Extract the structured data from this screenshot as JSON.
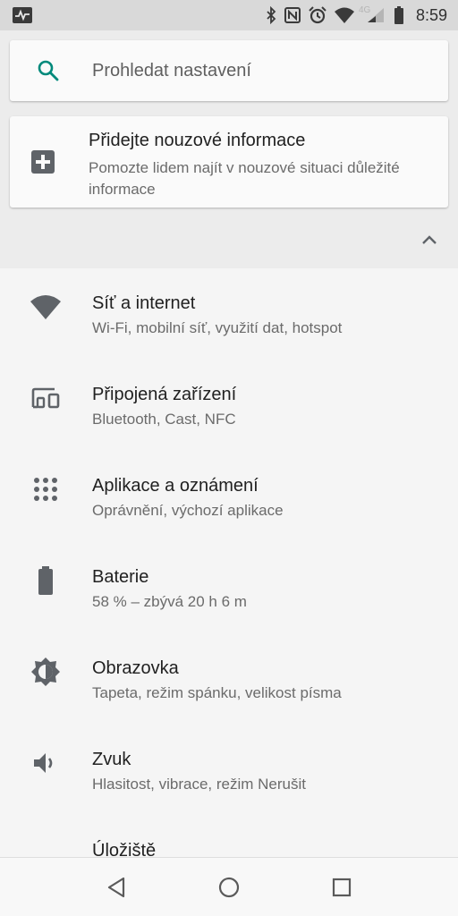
{
  "status_bar": {
    "time": "8:59",
    "network_label": "4G",
    "icons": [
      "activity-icon",
      "bluetooth-icon",
      "nfc-icon",
      "alarm-icon",
      "wifi-icon",
      "signal-icon",
      "battery-icon"
    ]
  },
  "search": {
    "placeholder": "Prohledat nastavení"
  },
  "suggestion": {
    "icon": "add-emergency-info-icon",
    "title": "Přidejte nouzové informace",
    "subtitle": "Pomozte lidem najít v nouzové situaci důležité informace"
  },
  "settings": {
    "items": [
      {
        "icon": "wifi-icon",
        "title": "Síť a internet",
        "subtitle": "Wi-Fi, mobilní síť, využití dat, hotspot"
      },
      {
        "icon": "connected-devices-icon",
        "title": "Připojená zařízení",
        "subtitle": "Bluetooth, Cast, NFC"
      },
      {
        "icon": "apps-icon",
        "title": "Aplikace a oznámení",
        "subtitle": "Oprávnění, výchozí aplikace"
      },
      {
        "icon": "battery-icon",
        "title": "Baterie",
        "subtitle": "58 % – zbývá 20 h 6 m"
      },
      {
        "icon": "display-brightness-icon",
        "title": "Obrazovka",
        "subtitle": "Tapeta, režim spánku, velikost písma"
      },
      {
        "icon": "volume-icon",
        "title": "Zvuk",
        "subtitle": "Hlasitost, vibrace, režim Nerušit"
      },
      {
        "icon": "storage-icon",
        "title": "Úložiště",
        "subtitle": ""
      }
    ]
  },
  "colors": {
    "accent": "#00897b",
    "icon": "#5f6368",
    "background": "#f5f5f5",
    "card": "#fafafa"
  }
}
